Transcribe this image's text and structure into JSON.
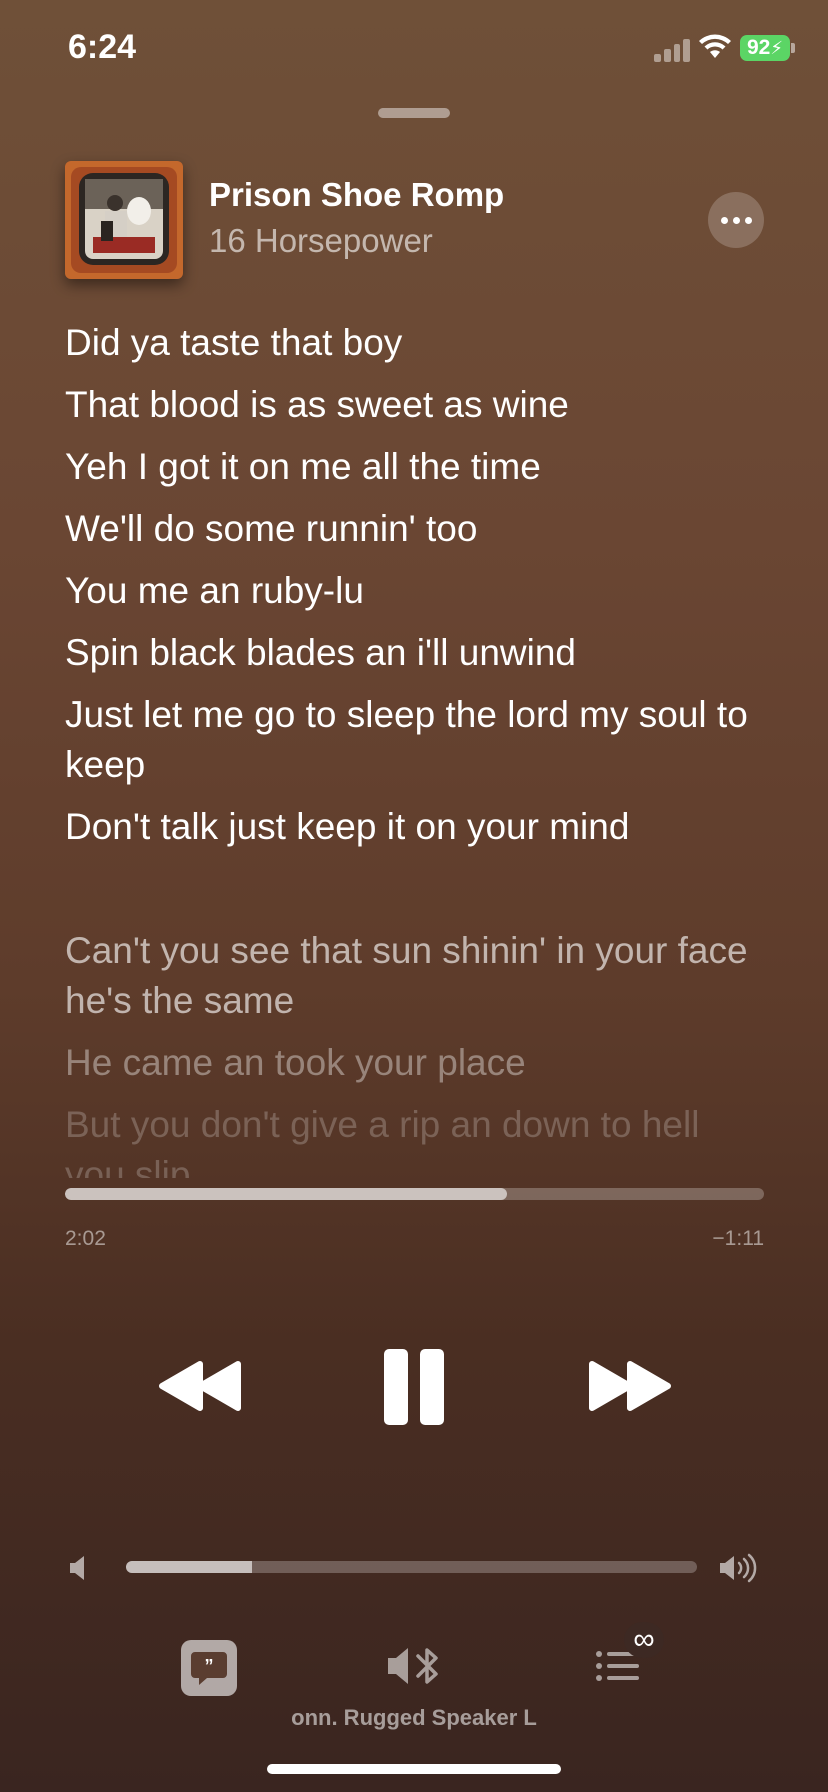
{
  "status_bar": {
    "time": "6:24",
    "battery": "92"
  },
  "now_playing": {
    "title": "Prison Shoe Romp",
    "artist": "16 Horsepower"
  },
  "lyrics": {
    "lines": [
      "Did ya taste that boy",
      "That blood is as sweet as wine",
      "Yeh I got it on me all the time",
      "We'll do some runnin' too",
      "You me an ruby-lu",
      "Spin black blades an i'll unwind",
      "Just let me go to sleep the lord my soul to keep",
      "Don't talk just keep it on your mind"
    ],
    "upcoming": [
      "Can't you see that sun shinin' in your face he's the same",
      "He came an took your place",
      "But you don't give a rip an down to hell you slip"
    ]
  },
  "playback": {
    "elapsed": "2:02",
    "remaining": "−1:11",
    "progress_fraction": 0.632,
    "volume_fraction": 0.22
  },
  "bottom_bar": {
    "device": "onn. Rugged Speaker L",
    "queue_badge": "∞"
  },
  "colors": {
    "battery": "#5bd565",
    "background_top": "#6f5038",
    "background_bottom": "#3a2520"
  },
  "icons": [
    "signal-icon",
    "wifi-icon",
    "battery-icon",
    "more-icon",
    "rewind-icon",
    "pause-icon",
    "fast-forward-icon",
    "volume-low-icon",
    "volume-high-icon",
    "lyrics-icon",
    "airplay-bluetooth-icon",
    "queue-icon",
    "infinity-icon"
  ]
}
